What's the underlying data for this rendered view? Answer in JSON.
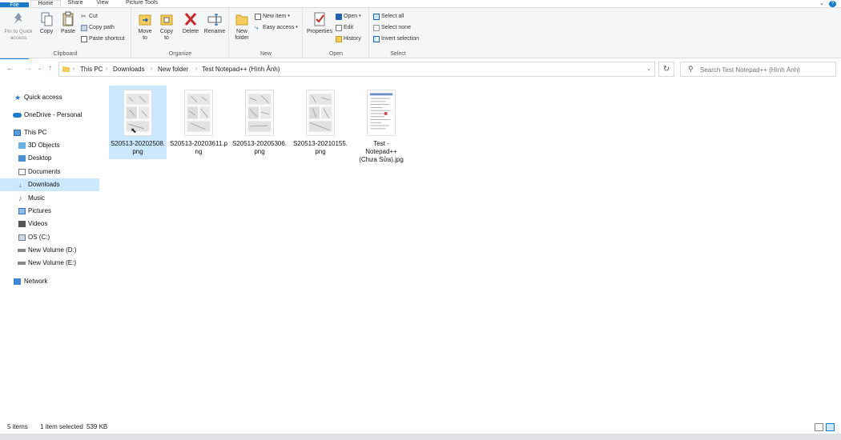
{
  "ribbon_tabs": [
    {
      "label": "File"
    },
    {
      "label": "Home"
    },
    {
      "label": "Share"
    },
    {
      "label": "View"
    },
    {
      "label": "Picture Tools"
    }
  ],
  "ribbon": {
    "clipboard": {
      "label": "Clipboard",
      "pin_label": "Pin to Quick access",
      "copy_label": "Copy",
      "paste_label": "Paste",
      "cut_label": "Cut",
      "copy_path_label": "Copy path",
      "paste_shortcut_label": "Paste shortcut"
    },
    "organize": {
      "label": "Organize",
      "move_to_label": "Move to",
      "copy_to_label": "Copy to",
      "delete_label": "Delete",
      "rename_label": "Rename"
    },
    "new": {
      "label": "New",
      "new_folder_label": "New folder",
      "new_item_label": "New item",
      "easy_access_label": "Easy access"
    },
    "open": {
      "label": "Open",
      "properties_label": "Properties",
      "open_label": "Open",
      "edit_label": "Edit",
      "history_label": "History"
    },
    "select": {
      "label": "Select",
      "select_all_label": "Select all",
      "select_none_label": "Select none",
      "invert_label": "Invert selection"
    }
  },
  "address": {
    "crumbs": [
      "This PC",
      "Downloads",
      "New folder",
      "Test Notepad++ (Hình Ảnh)"
    ],
    "search_placeholder": "Search Test Notepad++ (Hình Ảnh)"
  },
  "nav": {
    "items": [
      {
        "label": "Quick access",
        "icon": "star-icon"
      },
      {
        "label": "OneDrive - Personal",
        "icon": "cloud-icon"
      },
      {
        "label": "This PC",
        "icon": "computer-icon"
      },
      {
        "label": "3D Objects",
        "icon": "cube-icon"
      },
      {
        "label": "Desktop",
        "icon": "desktop-icon"
      },
      {
        "label": "Documents",
        "icon": "document-icon"
      },
      {
        "label": "Downloads",
        "icon": "download-icon"
      },
      {
        "label": "Music",
        "icon": "music-icon"
      },
      {
        "label": "Pictures",
        "icon": "picture-icon"
      },
      {
        "label": "Videos",
        "icon": "video-icon"
      },
      {
        "label": "OS (C:)",
        "icon": "drive-icon"
      },
      {
        "label": "New Volume (D:)",
        "icon": "drive-icon"
      },
      {
        "label": "New Volume (E:)",
        "icon": "drive-icon"
      },
      {
        "label": "Network",
        "icon": "network-icon"
      }
    ]
  },
  "files": [
    {
      "name": "S20513-20202508.png",
      "selected": true
    },
    {
      "name": "S20513-20203611.png",
      "selected": false
    },
    {
      "name": "S20513-20205306.png",
      "selected": false
    },
    {
      "name": "S20513-20210155.png",
      "selected": false
    },
    {
      "name": "Test - Notepad++ (Chưa Sửa).jpg",
      "selected": false
    }
  ],
  "status": {
    "item_count": "5 items",
    "selection": "1 item selected",
    "size": "539 KB"
  },
  "colors": {
    "accent": "#1979ca",
    "selection": "#cce8ff"
  }
}
